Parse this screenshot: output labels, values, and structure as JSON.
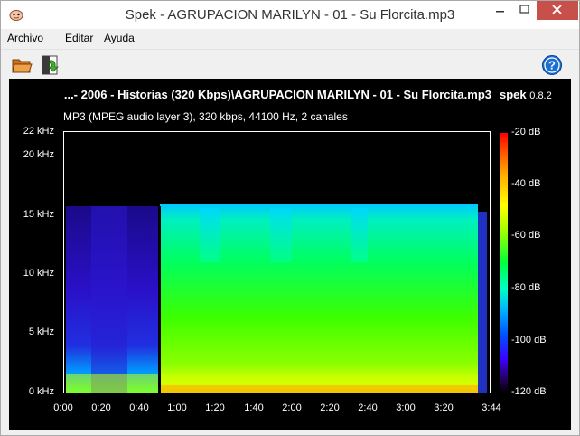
{
  "window": {
    "title": "Spek - AGRUPACION MARILYN - 01 - Su Florcita.mp3"
  },
  "menubar": {
    "items": [
      "Archivo",
      "Editar",
      "Ayuda"
    ]
  },
  "toolbar": {
    "open_icon": "folder-open-icon",
    "save_icon": "save-image-icon",
    "help_icon": "help-icon"
  },
  "spectrogram": {
    "file_label": "...- 2006 - Historias (320 Kbps)\\AGRUPACION MARILYN - 01 - Su Florcita.mp3",
    "brand_name": "spek",
    "brand_version": "0.8.2",
    "stream_info": "MP3 (MPEG audio layer 3), 320 kbps, 44100 Hz, 2 canales",
    "freq_axis": [
      "22 kHz",
      "20 kHz",
      "15 kHz",
      "10 kHz",
      "5 kHz",
      "0 kHz"
    ],
    "time_axis": [
      "0:00",
      "0:20",
      "0:40",
      "1:00",
      "1:20",
      "1:40",
      "2:00",
      "2:20",
      "2:40",
      "3:00",
      "3:20",
      "3:44"
    ],
    "db_axis": [
      "-20 dB",
      "-40 dB",
      "-60 dB",
      "-80 dB",
      "-100 dB",
      "-120 dB"
    ],
    "colors": {
      "background": "#000000",
      "hot": "#ff0000",
      "mid": "#00ff3c",
      "cold": "#3c00ff"
    }
  }
}
